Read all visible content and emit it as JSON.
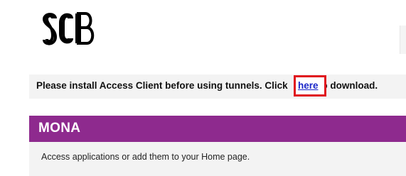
{
  "logo": {
    "text": "SCB"
  },
  "notice": {
    "before_link": "Please install Access Client before using tunnels. Click ",
    "link_label": "here",
    "after_link": "o download."
  },
  "section": {
    "title": "MONA",
    "description": "Access applications or add them to your Home page."
  },
  "colors": {
    "section_header_bg": "#8e2a8e",
    "highlight_border": "#e0141e",
    "link": "#1a27c9"
  }
}
